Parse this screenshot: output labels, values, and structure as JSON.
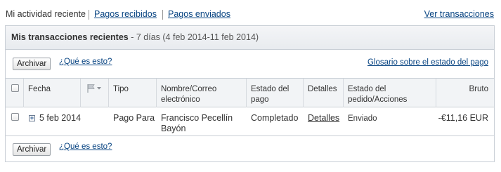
{
  "tabs": {
    "activity": "Mi actividad reciente",
    "received": "Pagos recibidos",
    "sent": "Pagos enviados",
    "view_all": "Ver transacciones"
  },
  "panel": {
    "title_bold": "Mis transacciones recientes",
    "title_range": " - 7 días (4 feb 2014-11 feb 2014)",
    "archive_label": "Archivar",
    "whats_this": "¿Qué es esto?",
    "glossary_link": "Glosario sobre el estado del pago"
  },
  "table": {
    "headers": {
      "date": "Fecha",
      "type": "Tipo",
      "name": "Nombre/Correo electrónico",
      "status": "Estado del pago",
      "details": "Detalles",
      "order_status": "Estado del pedido/Acciones",
      "gross": "Bruto"
    },
    "rows": [
      {
        "date": "5 feb 2014",
        "type": "Pago Para",
        "name": "Francisco Pecellín Bayón",
        "status": "Completado",
        "details": "Detalles",
        "order_status": "Enviado",
        "gross": "-€11,16 EUR"
      }
    ]
  },
  "icons": {
    "flag": "flag-icon",
    "dropdown": "chevron-down-icon",
    "expand": "plus-icon"
  },
  "colors": {
    "link": "#084482",
    "header_bg": "#f2f4f6",
    "border": "#c9cfd6"
  }
}
